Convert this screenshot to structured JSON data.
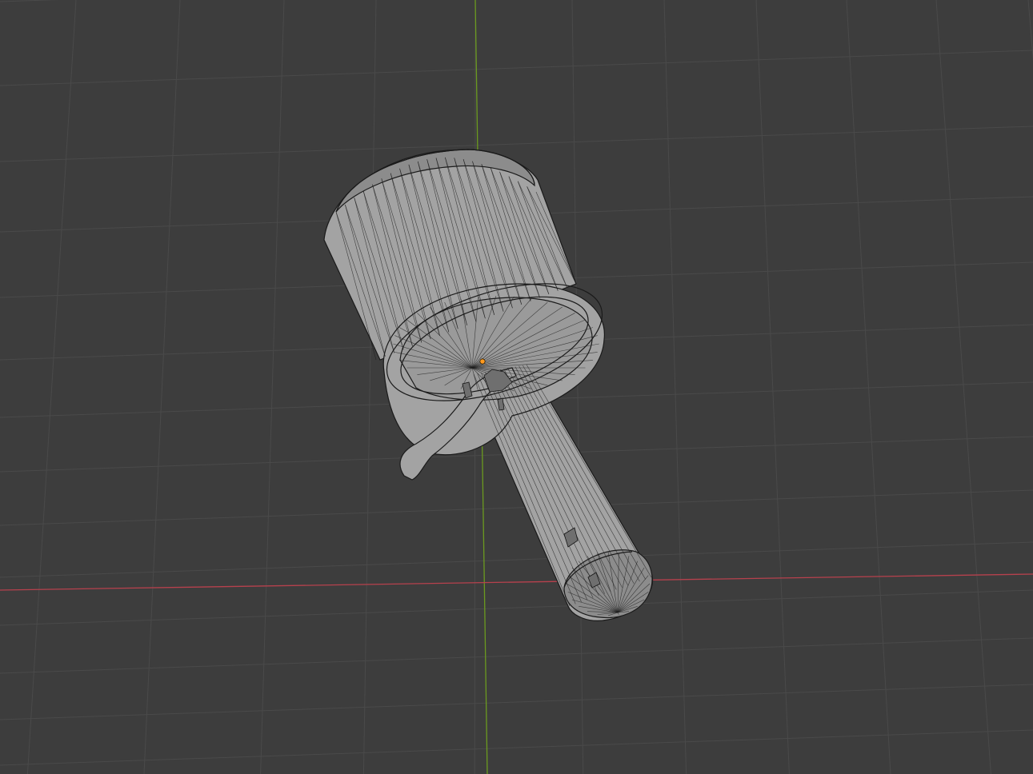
{
  "viewport": {
    "background": "#3d3d3d",
    "grid_color": "#4a4a4a",
    "axis_x_color": "#b7414d",
    "axis_y_color": "#6b9a1f",
    "mesh_fill": "#a3a3a3",
    "mesh_shade": "#8c8c8c",
    "mesh_inner": "#9a9a9a",
    "wire_color": "#1e1e1e",
    "origin_color": "#ff9a1f",
    "icons": {
      "origin": "object-origin-icon",
      "mesh": "wireframe-mesh-icon"
    }
  }
}
